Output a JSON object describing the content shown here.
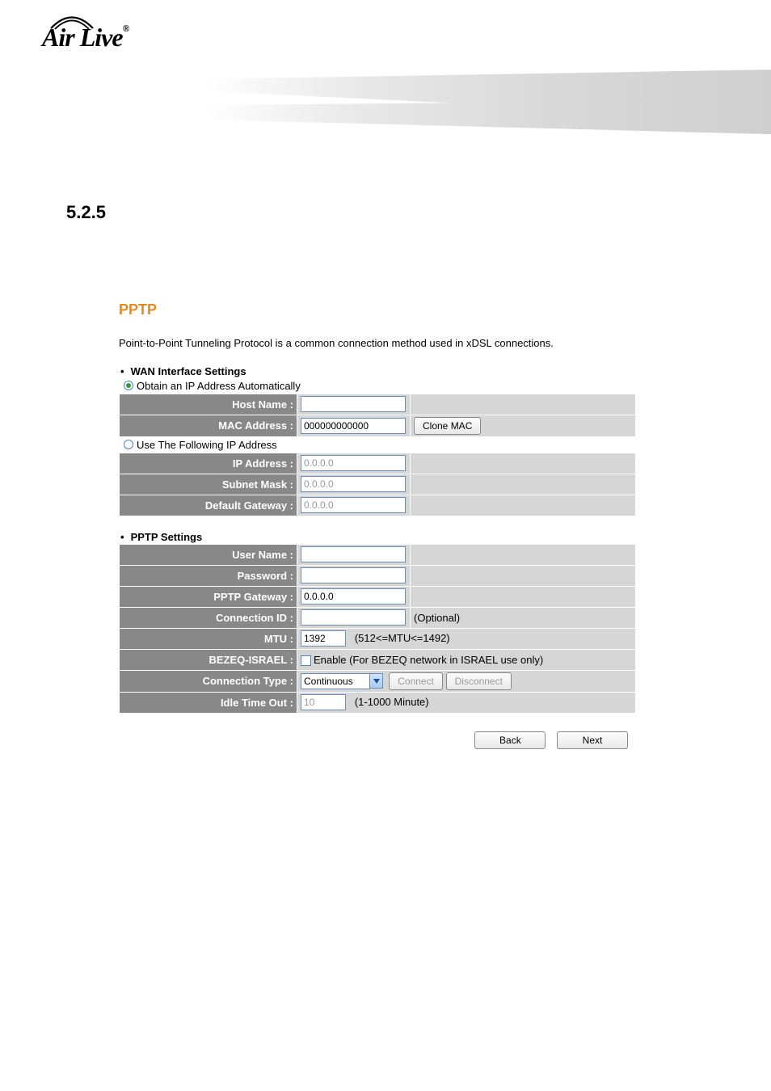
{
  "brand": "Air Live",
  "section_number": "5.2.5",
  "panel": {
    "title": "PPTP",
    "description": "Point-to-Point Tunneling Protocol is a common connection method used in xDSL connections."
  },
  "wan": {
    "heading": "WAN Interface Settings",
    "radio_auto": "Obtain an IP Address Automatically",
    "radio_static": "Use The Following IP Address",
    "selected_mode": "auto",
    "labels": {
      "host_name": "Host Name :",
      "mac_address": "MAC Address :",
      "ip_address": "IP Address :",
      "subnet_mask": "Subnet Mask :",
      "default_gateway": "Default Gateway :"
    },
    "values": {
      "host_name": "",
      "mac_address": "000000000000",
      "ip_address": "0.0.0.0",
      "subnet_mask": "0.0.0.0",
      "default_gateway": "0.0.0.0"
    },
    "clone_mac_btn": "Clone MAC"
  },
  "pptp": {
    "heading": "PPTP Settings",
    "labels": {
      "user_name": "User Name :",
      "password": "Password :",
      "gateway": "PPTP Gateway :",
      "connection_id": "Connection ID :",
      "mtu": "MTU :",
      "bezeq": "BEZEQ-ISRAEL :",
      "connection_type": "Connection Type :",
      "idle_timeout": "Idle Time Out :"
    },
    "values": {
      "user_name": "",
      "password": "",
      "gateway": "0.0.0.0",
      "connection_id": "",
      "mtu": "1392",
      "bezeq_enabled": false,
      "connection_type": "Continuous",
      "idle_timeout": "10"
    },
    "hints": {
      "connection_id": "(Optional)",
      "mtu": "(512<=MTU<=1492)",
      "bezeq": "Enable (For BEZEQ network in ISRAEL use only)",
      "idle_timeout": "(1-1000 Minute)"
    },
    "buttons": {
      "connect": "Connect",
      "disconnect": "Disconnect"
    }
  },
  "footer": {
    "back": "Back",
    "next": "Next"
  }
}
